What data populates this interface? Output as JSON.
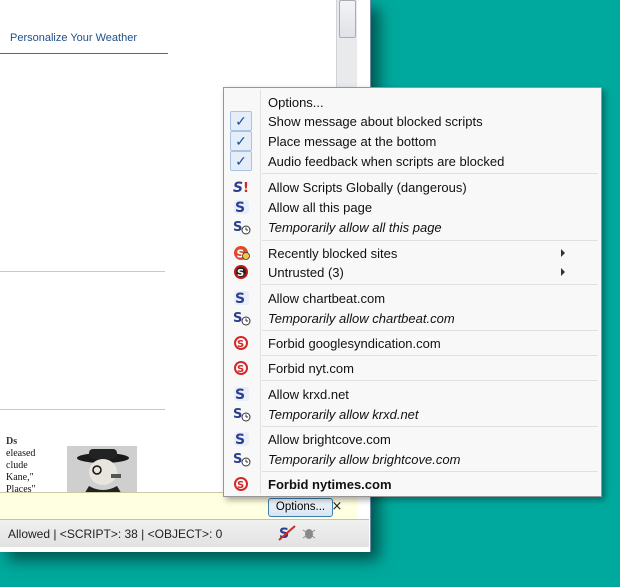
{
  "page": {
    "weather_link": "Personalize Your Weather",
    "article_heading": "Ds",
    "article_lines": [
      "eleased",
      "clude",
      "Kane,\"",
      "Places\""
    ]
  },
  "notification": {
    "options_label": "Options...",
    "close_label": "×"
  },
  "status_bar": {
    "text": "Allowed | <SCRIPT>: 38 | <OBJECT>: 0"
  },
  "menu": {
    "options_title": "Options...",
    "checks": [
      {
        "label": "Show message about blocked scripts",
        "checked": true
      },
      {
        "label": "Place message at the bottom",
        "checked": true
      },
      {
        "label": "Audio feedback when scripts are blocked",
        "checked": true
      }
    ],
    "global": [
      {
        "label": "Allow Scripts Globally (dangerous)",
        "icon": "noscript-global-icon"
      },
      {
        "label": "Allow all this page",
        "icon": "noscript-allow-icon"
      },
      {
        "label": "Temporarily allow all this page",
        "icon": "noscript-temp-icon"
      }
    ],
    "submenus": [
      {
        "label": "Recently blocked sites",
        "icon": "recent-blocked-icon"
      },
      {
        "label": "Untrusted (3)",
        "icon": "untrusted-icon"
      }
    ],
    "sites": [
      {
        "label": "Allow chartbeat.com",
        "style": "normal",
        "icon": "noscript-allow-icon"
      },
      {
        "label": "Temporarily allow chartbeat.com",
        "style": "italic",
        "icon": "noscript-temp-icon"
      },
      {
        "label": "Forbid googlesyndication.com",
        "style": "normal",
        "icon": "noscript-forbid-icon"
      },
      {
        "label": "Forbid nyt.com",
        "style": "normal",
        "icon": "noscript-forbid-icon"
      },
      {
        "label": "Allow krxd.net",
        "style": "normal",
        "icon": "noscript-allow-icon"
      },
      {
        "label": "Temporarily allow krxd.net",
        "style": "italic",
        "icon": "noscript-temp-icon"
      },
      {
        "label": "Allow brightcove.com",
        "style": "normal",
        "icon": "noscript-allow-icon"
      },
      {
        "label": "Temporarily allow brightcove.com",
        "style": "italic",
        "icon": "noscript-temp-icon"
      },
      {
        "label": "Forbid nytimes.com",
        "style": "bold",
        "icon": "noscript-forbid-icon"
      }
    ]
  },
  "colors": {
    "desktop": "#00a99d",
    "noscript_blue": "#2a3f8f",
    "forbid_red": "#d22828"
  }
}
